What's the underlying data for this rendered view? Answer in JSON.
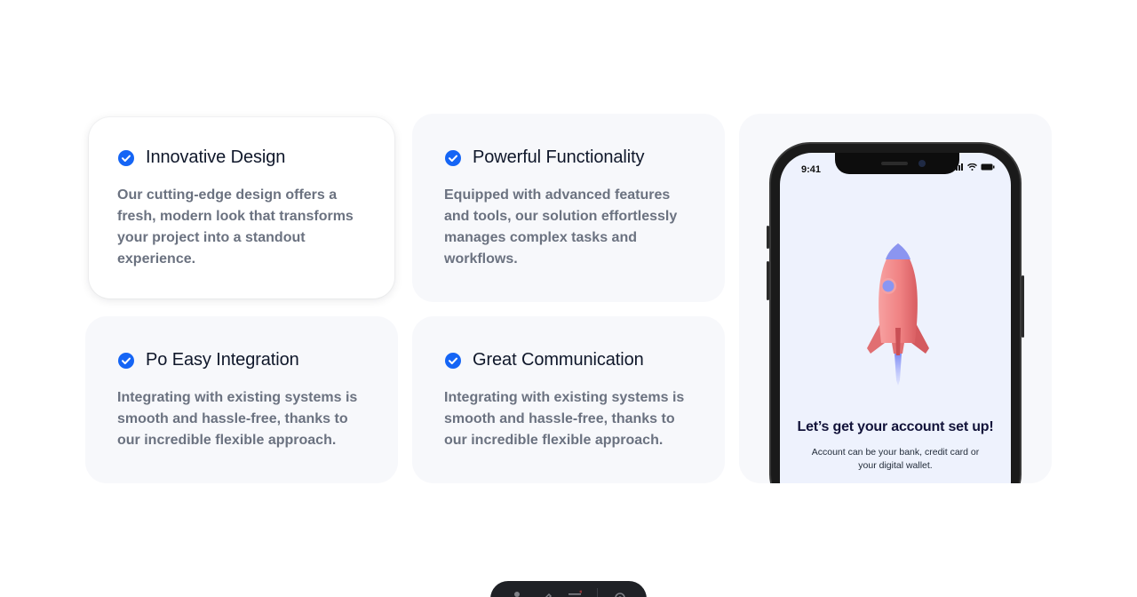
{
  "features": [
    {
      "title": "Innovative Design",
      "description": "Our cutting-edge design offers a fresh, modern look that transforms your project into a standout experience."
    },
    {
      "title": "Powerful Functionality",
      "description": "Equipped with advanced features and tools, our solution effortlessly manages complex tasks and workflows."
    },
    {
      "title": "Po Easy Integration",
      "description": "Integrating with existing systems is smooth and hassle-free, thanks to our incredible flexible approach."
    },
    {
      "title": "Great Communication",
      "description": "Integrating with existing systems is smooth and hassle-free, thanks to our incredible flexible approach."
    }
  ],
  "phone": {
    "time": "9:41",
    "title": "Let’s get your account set up!",
    "subtitle": "Account can be your bank, credit card or your digital wallet."
  },
  "colors": {
    "accent": "#1565f5",
    "card_bg": "#f7f8fb",
    "title_text": "#0f172a",
    "body_text": "#6b7280",
    "phone_heading": "#12133a",
    "rocket_body": "#f08283"
  },
  "icons": {
    "feature_check": "check-circle-icon",
    "dock": [
      "user-icon",
      "pen-icon",
      "menu-icon",
      "gear-icon"
    ]
  }
}
